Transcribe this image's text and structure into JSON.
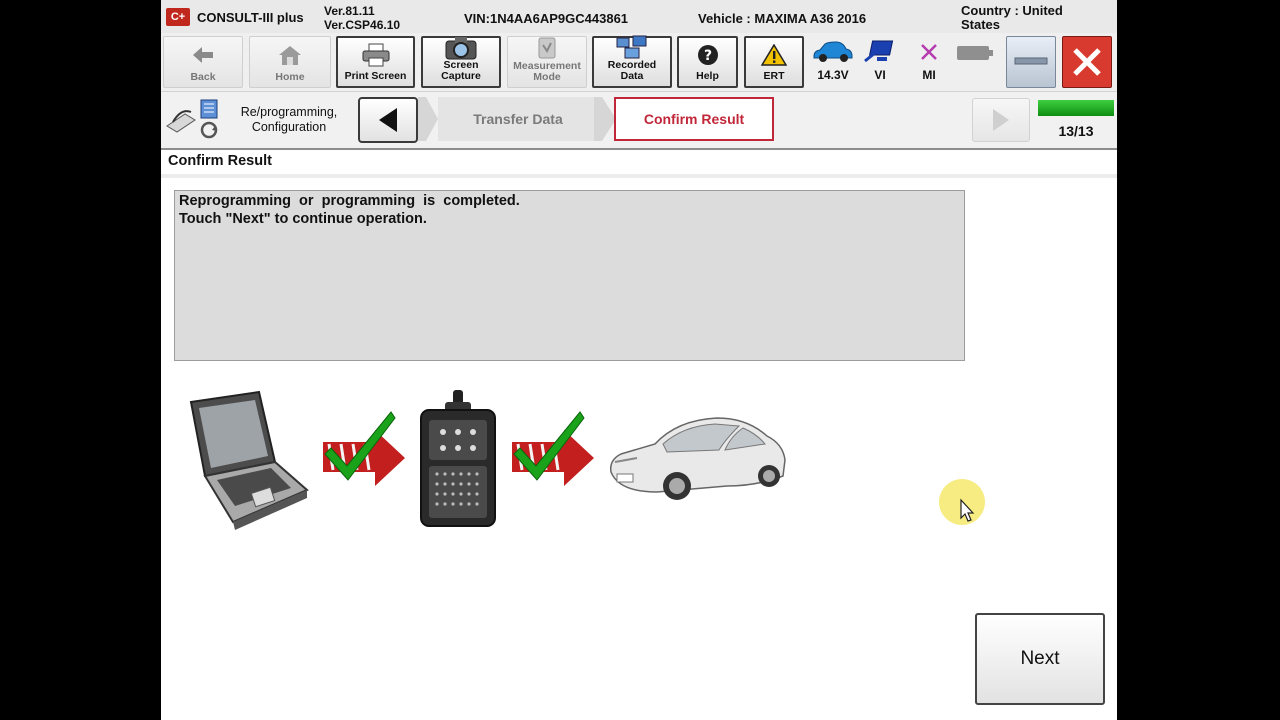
{
  "titlebar": {
    "app_name": "CONSULT-III plus",
    "version_1": "Ver.81.11",
    "version_2": "Ver.CSP46.10",
    "vin": "VIN:1N4AA6AP9GC443861",
    "vehicle": "Vehicle : MAXIMA A36 2016",
    "country": "Country : United States"
  },
  "toolbar": {
    "back": "Back",
    "home": "Home",
    "print_screen": "Print Screen",
    "screen_capture_1": "Screen",
    "screen_capture_2": "Capture",
    "measurement_1": "Measurement",
    "measurement_2": "Mode",
    "recorded_1": "Recorded",
    "recorded_2": "Data",
    "help": "Help",
    "ert": "ERT",
    "battery_voltage": "14.3V",
    "vi": "VI",
    "mi": "MI"
  },
  "stepbar": {
    "name_1": "Re/programming,",
    "name_2": "Configuration",
    "prev_step": "Transfer Data",
    "current_step": "Confirm Result",
    "progress_text": "13/13",
    "progress_fraction": 1.0
  },
  "content": {
    "section_title": "Confirm Result",
    "message_line_1": "Reprogramming  or  programming  is  completed.",
    "message_line_2": "Touch \"Next\" to continue operation."
  },
  "buttons": {
    "next": "Next"
  },
  "colors": {
    "accent_red": "#c0281e",
    "progress_green": "#11a11a",
    "current_step_border": "#c0283a"
  }
}
